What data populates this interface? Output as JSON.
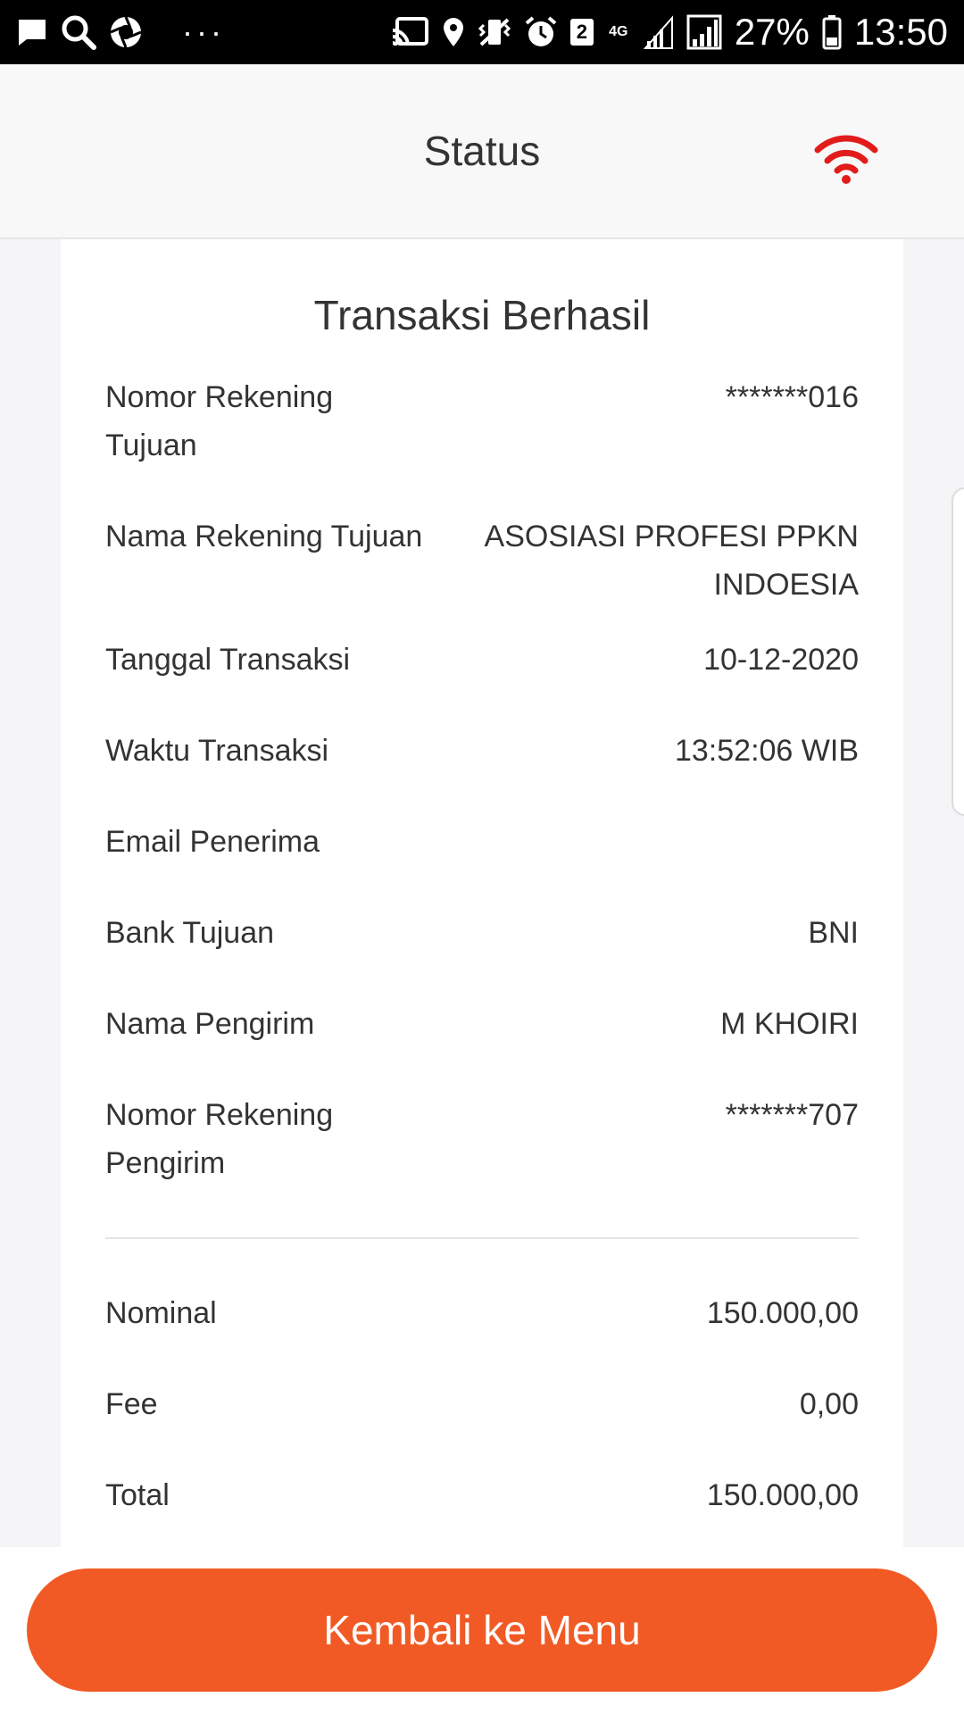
{
  "status_bar": {
    "icons_left": [
      "message-icon",
      "search-icon",
      "aperture-icon"
    ],
    "overflow": "···",
    "icons_right": [
      "cast-icon",
      "location-icon",
      "vibrate-icon",
      "alarm-icon"
    ],
    "sim_badge": "2",
    "network": "4G",
    "battery": "27%",
    "time": "13:50"
  },
  "header": {
    "title": "Status",
    "connection_icon": "wifi-icon",
    "connection_color": "#e21b1b"
  },
  "card": {
    "status_color": "#8cc63f",
    "title": "Transaksi Berhasil",
    "details": [
      {
        "label": "Nomor Rekening Tujuan",
        "value": "*******016"
      },
      {
        "label": "Nama Rekening Tujuan",
        "value": "ASOSIASI PROFESI PPKN INDOESIA"
      },
      {
        "label": "Tanggal Transaksi",
        "value": "10-12-2020"
      },
      {
        "label": "Waktu Transaksi",
        "value": "13:52:06 WIB"
      },
      {
        "label": "Email Penerima",
        "value": ""
      },
      {
        "label": "Bank Tujuan",
        "value": "BNI"
      },
      {
        "label": "Nama Pengirim",
        "value": "M KHOIRI"
      },
      {
        "label": "Nomor Rekening Pengirim",
        "value": "*******707"
      }
    ],
    "amounts": [
      {
        "label": "Nominal",
        "value": "150.000,00"
      },
      {
        "label": "Fee",
        "value": "0,00"
      },
      {
        "label": "Total",
        "value": "150.000,00"
      }
    ]
  },
  "footer": {
    "button_label": "Kembali ke Menu",
    "button_color": "#f15a24"
  }
}
